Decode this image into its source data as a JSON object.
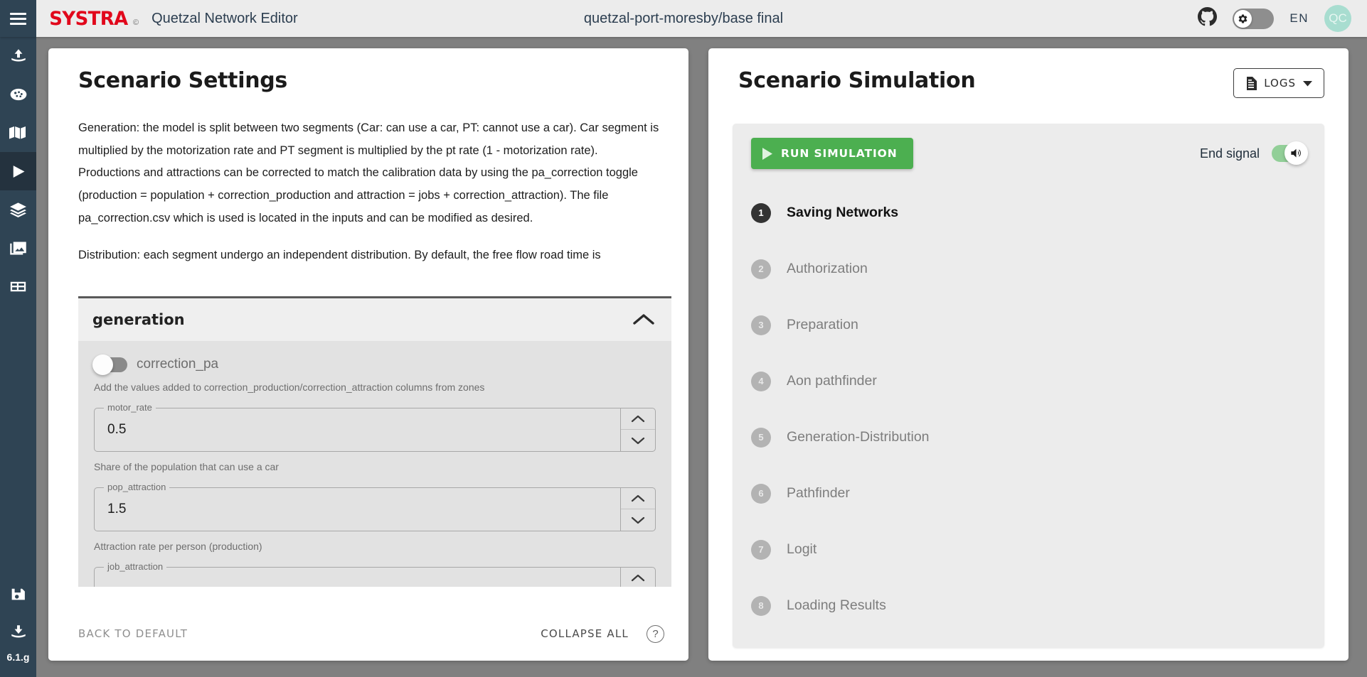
{
  "topbar": {
    "menu_icon": "hamburger-icon",
    "brand": "SYSTRA",
    "brand_copyright": "©",
    "app_title": "Quetzal Network Editor",
    "center_title": "quetzal-port-moresby/base final",
    "github_icon": "github-icon",
    "theme_toggle_icon": "gear-icon",
    "language": "EN",
    "avatar_initials": "QC"
  },
  "rail": {
    "items": [
      {
        "name": "upload-icon",
        "label": "Upload"
      },
      {
        "name": "dashboard-icon",
        "label": "Dashboard"
      },
      {
        "name": "map-icon",
        "label": "Map"
      },
      {
        "name": "run-icon",
        "label": "Run",
        "active": true
      },
      {
        "name": "layers-icon",
        "label": "Layers"
      },
      {
        "name": "image-icon",
        "label": "Images"
      },
      {
        "name": "table-icon",
        "label": "Table"
      },
      {
        "name": "save-icon",
        "label": "Save"
      },
      {
        "name": "download-icon",
        "label": "Download"
      }
    ],
    "version": "6.1.g"
  },
  "settings": {
    "title": "Scenario Settings",
    "description_paragraphs": [
      "Generation: the model is split between two segments (Car: can use a car, PT: cannot use a car). Car segment is multiplied by the motorization rate and PT segment is multiplied by the pt rate (1 - motorization rate). Productions and attractions can be corrected to match the calibration data by using the pa_correction toggle (production = population + correction_production and attraction = jobs + correction_attraction). The file pa_correction.csv which is used is located in the inputs and can be modified as desired.",
      "Distribution: each segment undergo an independent distribution. By default, the free flow road time is"
    ],
    "section": {
      "name": "generation",
      "collapse_icon": "chevron-up-icon",
      "toggle": {
        "label": "correction_pa",
        "value": "off",
        "hint": "Add the values added to correction_production/correction_attraction columns from zones"
      },
      "fields": [
        {
          "label": "motor_rate",
          "value": "0.5",
          "hint": "Share of the population that can use a car"
        },
        {
          "label": "pop_attraction",
          "value": "1.5",
          "hint": "Attraction rate per person (production)"
        },
        {
          "label": "job_attraction",
          "value": "",
          "hint": ""
        }
      ]
    },
    "footer": {
      "back_to_default": "BACK TO DEFAULT",
      "collapse_all": "COLLAPSE ALL",
      "help_icon": "question-mark-icon",
      "help_glyph": "?"
    }
  },
  "simulation": {
    "title": "Scenario Simulation",
    "logs_button": {
      "label": "LOGS",
      "doc_icon": "document-icon",
      "caret_icon": "caret-down-icon"
    },
    "run_button": {
      "label": "RUN SIMULATION",
      "play_icon": "play-icon"
    },
    "end_signal": {
      "label": "End signal",
      "value": "on",
      "icon": "volume-up-icon"
    },
    "steps": [
      {
        "num": "1",
        "label": "Saving Networks",
        "active": true
      },
      {
        "num": "2",
        "label": "Authorization",
        "active": false
      },
      {
        "num": "3",
        "label": "Preparation",
        "active": false
      },
      {
        "num": "4",
        "label": "Aon pathfinder",
        "active": false
      },
      {
        "num": "5",
        "label": "Generation-Distribution",
        "active": false
      },
      {
        "num": "6",
        "label": "Pathfinder",
        "active": false
      },
      {
        "num": "7",
        "label": "Logit",
        "active": false
      },
      {
        "num": "8",
        "label": "Loading Results",
        "active": false
      }
    ]
  },
  "colors": {
    "rail_bg": "#2f4454",
    "brand_red": "#e1071b",
    "accent_green": "#4caf50",
    "page_bg": "#808080",
    "avatar_bg": "#a8ddd0"
  }
}
